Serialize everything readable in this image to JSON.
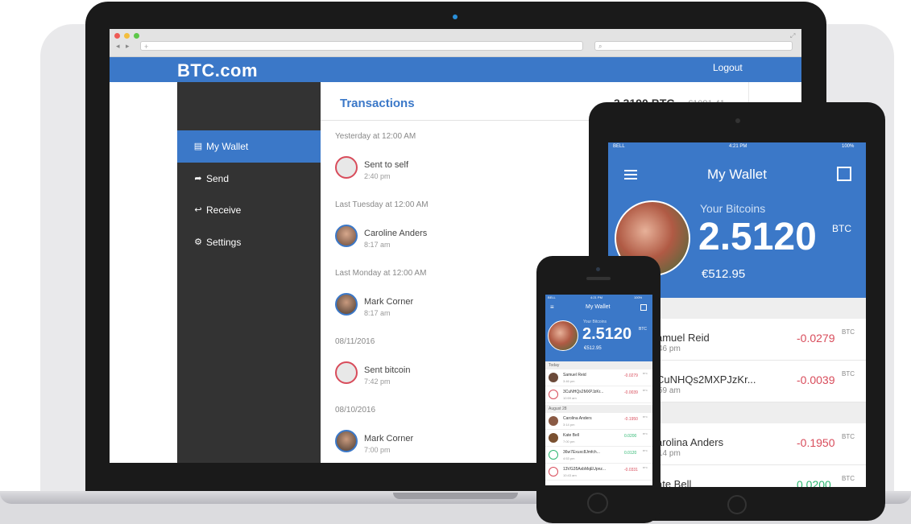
{
  "laptop": {
    "browser": {
      "url_placeholder": "+",
      "search_placeholder": "⌕",
      "back": "◂",
      "forward": "▸"
    },
    "brand": "BTC.com",
    "logout": "Logout",
    "sidebar": {
      "items": [
        {
          "label": "My Wallet",
          "icon": "wallet-icon",
          "glyph": "▤"
        },
        {
          "label": "Send",
          "icon": "send-icon",
          "glyph": "➦"
        },
        {
          "label": "Receive",
          "icon": "receive-icon",
          "glyph": "↩"
        },
        {
          "label": "Settings",
          "icon": "gear-icon",
          "glyph": "⚙"
        }
      ]
    },
    "main": {
      "title": "Transactions",
      "balance_btc": "3.3190 BTC",
      "balance_eur": "€1081.41",
      "groups": [
        {
          "date": "Yesterday at 12:00 AM",
          "name": "Sent to self",
          "time": "2:40 pm",
          "type": "out"
        },
        {
          "date": "Last Tuesday at 12:00 AM",
          "name": "Caroline Anders",
          "time": "8:17 am",
          "type": "in"
        },
        {
          "date": "Last Monday at 12:00 AM",
          "name": "Mark Corner",
          "time": "8:17 am",
          "type": "in"
        },
        {
          "date": "08/11/2016",
          "name": "Sent bitcoin",
          "time": "7:42 pm",
          "type": "out"
        },
        {
          "date": "08/10/2016",
          "name": "Mark Corner",
          "time": "7:00 pm",
          "type": "in"
        }
      ]
    }
  },
  "tablet": {
    "status": {
      "carrier": "BELL",
      "time": "4:21 PM",
      "battery": "100%"
    },
    "title": "My Wallet",
    "your_bitcoins": "Your Bitcoins",
    "amount": "2.5120",
    "unit": "BTC",
    "eur": "€512.95",
    "rows": [
      {
        "name": "amuel Reid",
        "time": "46 pm",
        "amount": "-0.0279",
        "unit": "BTC"
      },
      {
        "name": "CuNHQs2MXPJzKr...",
        "time": "59 am",
        "amount": "-0.0039",
        "unit": "BTC"
      },
      {
        "name": "arolina Anders",
        "time": "14 pm",
        "amount": "-0.1950",
        "unit": "BTC"
      },
      {
        "name": "ate Bell",
        "time": "",
        "amount": "0.0200",
        "unit": "BTC"
      }
    ]
  },
  "phone": {
    "status": {
      "carrier": "BELL",
      "time": "4:21 PM",
      "battery": "100%"
    },
    "title": "My Wallet",
    "your_bitcoins": "Your Bitcoins",
    "amount": "2.5120",
    "unit": "BTC",
    "eur": "€512.95",
    "sections": [
      {
        "label": "Today",
        "rows": [
          {
            "name": "Samuel Reid",
            "time": "3:46 pm",
            "amount": "-0.0279",
            "unit": "BTC",
            "type": "out"
          },
          {
            "name": "3CuNHQs2MXPJzKr...",
            "time": "10:59 am",
            "amount": "-0.0039",
            "unit": "BTC",
            "type": "out"
          }
        ]
      },
      {
        "label": "August 28",
        "rows": [
          {
            "name": "Carolina Anders",
            "time": "3:14 pm",
            "amount": "-0.1950",
            "unit": "BTC",
            "type": "out"
          },
          {
            "name": "Kate Bell",
            "time": "7:00 pm",
            "amount": "0.0200",
            "unit": "BTC",
            "type": "in"
          },
          {
            "name": "36w7Exuxc8Jmfch...",
            "time": "4:53 pm",
            "amount": "0.0120",
            "unit": "BTC",
            "type": "in"
          },
          {
            "name": "13VG35AxbMqEUpnz...",
            "time": "10:43 am",
            "amount": "-0.0331",
            "unit": "BTC",
            "type": "out"
          }
        ]
      }
    ]
  },
  "colors": {
    "accent": "#3b78c8",
    "sidebar": "#333333",
    "negative": "#d84c5b",
    "positive": "#2eb872"
  }
}
